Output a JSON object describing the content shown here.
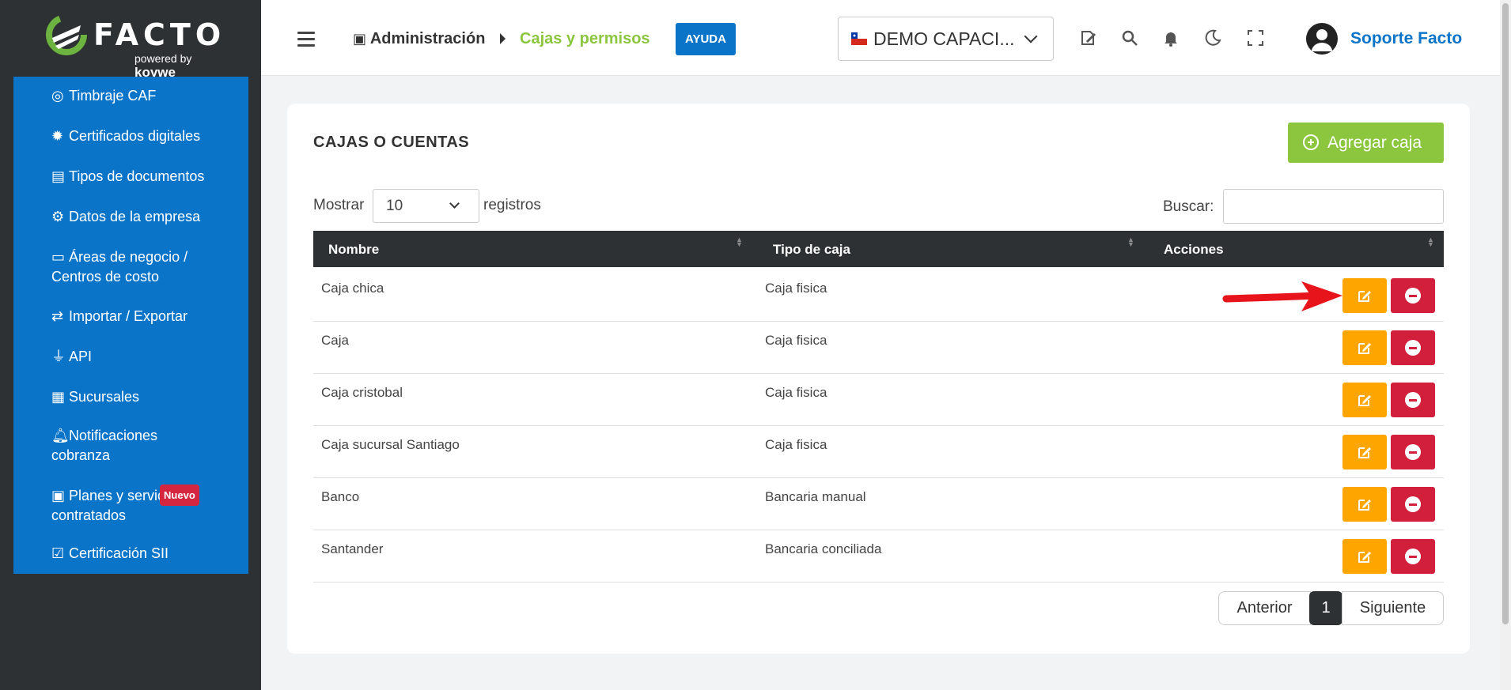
{
  "brand": {
    "name": "FACTO",
    "powered_prefix": "powered",
    "powered_by": "by",
    "powered_company": "koywe"
  },
  "sidebar": {
    "items": [
      {
        "label": "Timbraje CAF",
        "icon": "target-icon"
      },
      {
        "label": "Certificados digitales",
        "icon": "badge-icon"
      },
      {
        "label": "Tipos de documentos",
        "icon": "document-icon"
      },
      {
        "label": "Datos de la empresa",
        "icon": "gear-icon"
      },
      {
        "label": "Áreas de negocio /",
        "label2": "Centros de costo",
        "icon": "archive-icon"
      },
      {
        "label": "Importar / Exportar",
        "icon": "exchange-icon"
      },
      {
        "label": "API",
        "icon": "plug-icon"
      },
      {
        "label": "Sucursales",
        "icon": "building-icon"
      },
      {
        "label": "Notificaciones",
        "label2": "cobranza",
        "icon": "bell-icon"
      },
      {
        "label": "Planes y servic",
        "label2": "contratados",
        "badge": "Nuevo",
        "icon": "card-icon"
      },
      {
        "label": "Certificación SII",
        "icon": "check-square-icon"
      }
    ]
  },
  "header": {
    "breadcrumb_root": "Administración",
    "breadcrumb_current": "Cajas y permisos",
    "help_label": "AYUDA",
    "company_selected": "DEMO CAPACI...",
    "user_name": "Soporte Facto"
  },
  "main": {
    "card_title": "CAJAS O CUENTAS",
    "add_button": "Agregar caja",
    "show_label": "Mostrar",
    "page_length": "10",
    "records_label": "registros",
    "search_label": "Buscar:",
    "search_value": "",
    "columns": [
      "Nombre",
      "Tipo de caja",
      "Acciones"
    ],
    "rows": [
      {
        "name": "Caja chica",
        "type": "Caja fisica"
      },
      {
        "name": "Caja",
        "type": "Caja fisica"
      },
      {
        "name": "Caja cristobal",
        "type": "Caja fisica"
      },
      {
        "name": "Caja sucursal Santiago",
        "type": "Caja fisica"
      },
      {
        "name": "Banco",
        "type": "Bancaria manual"
      },
      {
        "name": "Santander",
        "type": "Bancaria conciliada"
      }
    ],
    "pagination": {
      "prev": "Anterior",
      "current": "1",
      "next": "Siguiente"
    }
  },
  "colors": {
    "primary_blue": "#0a74c8",
    "accent_green": "#8cc63f",
    "sidebar_dark": "#2e3134",
    "edit_orange": "#ffa500",
    "delete_red": "#d11f3c",
    "annotation_arrow": "#e8141c"
  }
}
